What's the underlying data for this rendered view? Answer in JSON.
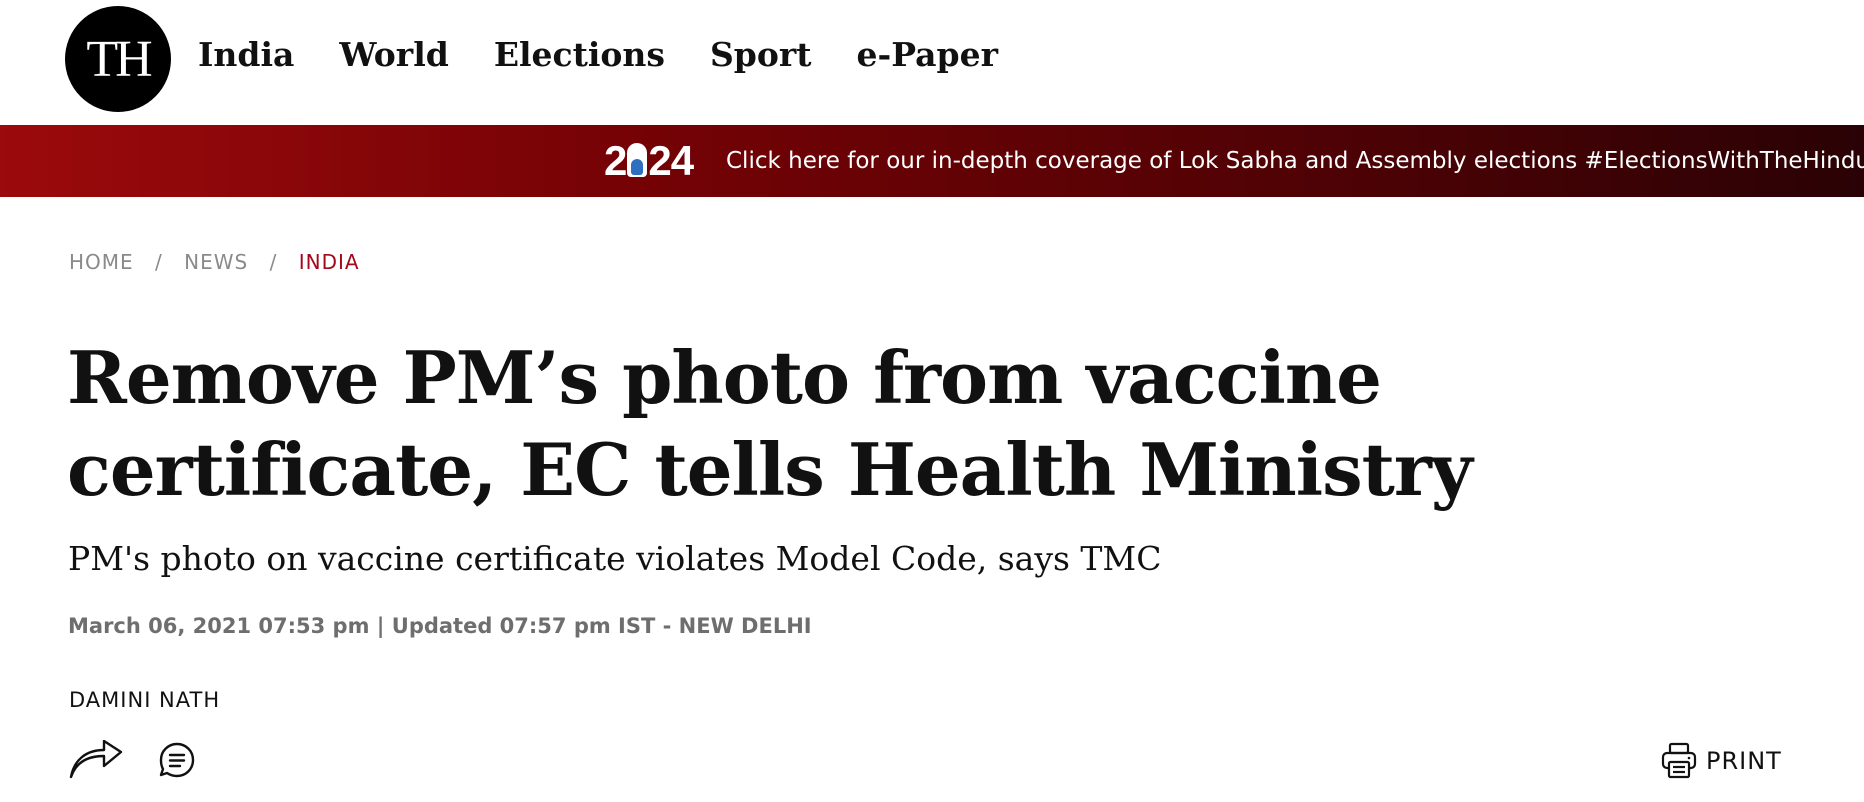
{
  "header": {
    "logo_text": "TH",
    "nav": [
      {
        "label": "India"
      },
      {
        "label": "World"
      },
      {
        "label": "Elections"
      },
      {
        "label": "Sport"
      },
      {
        "label": "e-Paper"
      }
    ]
  },
  "banner": {
    "year_start": "2",
    "year_end": "24",
    "text": "Click here for our in-depth coverage of Lok Sabha and Assembly elections #ElectionsWithTheHindu",
    "colors": {
      "start": "#9b0a0c",
      "end": "#2a0205"
    }
  },
  "breadcrumb": {
    "items": [
      {
        "label": "HOME"
      },
      {
        "label": "NEWS"
      },
      {
        "label": "INDIA"
      }
    ],
    "separator": "/"
  },
  "article": {
    "headline": "Remove PM’s photo from vaccine certificate, EC tells Health Ministry",
    "subheadline": "PM's photo on vaccine certificate violates Model Code, says TMC",
    "dateline": "March 06, 2021 07:53 pm | Updated 07:57 pm IST - NEW DELHI",
    "author": "DAMINI NATH"
  },
  "actions": {
    "share_icon": "share-arrow-icon",
    "comment_icon": "comment-bubble-icon",
    "print_icon": "printer-icon",
    "print_label": "PRINT"
  },
  "colors": {
    "accent": "#a3081b",
    "muted": "#8a8a8a"
  }
}
